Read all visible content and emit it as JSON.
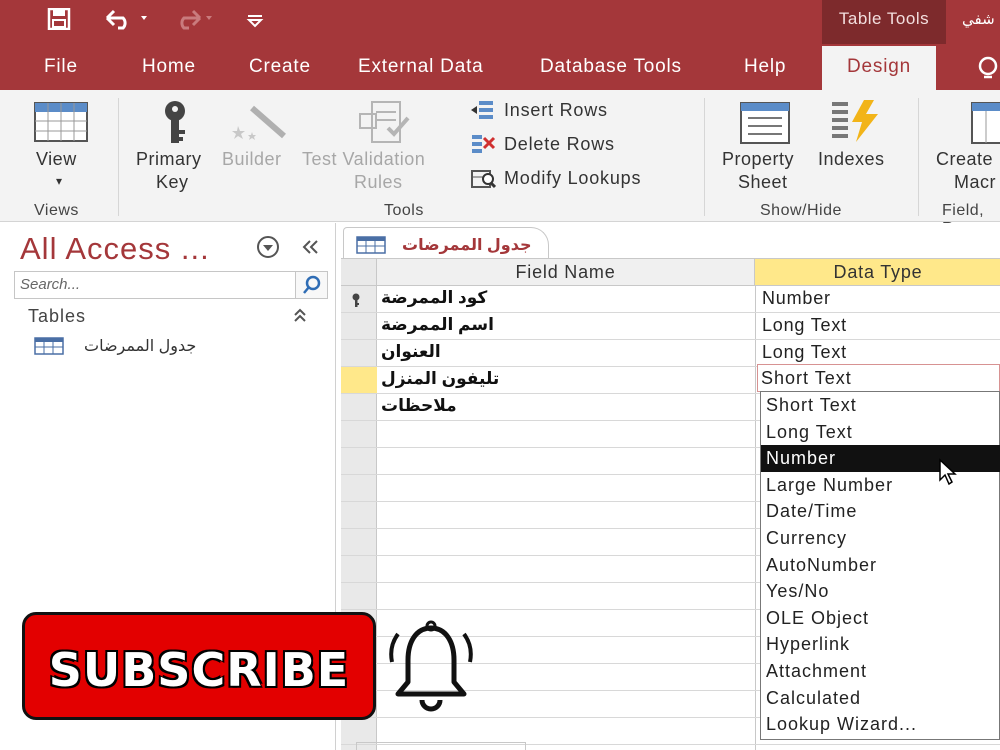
{
  "title_bar": {
    "context_tab": "Table Tools",
    "title_partial": "شفي"
  },
  "ribbon_tabs": [
    "File",
    "Home",
    "Create",
    "External Data",
    "Database Tools",
    "Help",
    "Design"
  ],
  "ribbon": {
    "view": {
      "label": "View",
      "group": "Views"
    },
    "primary_key": {
      "line1": "Primary",
      "line2": "Key"
    },
    "builder": "Builder",
    "test_validation": {
      "line1": "Test Validation",
      "line2": "Rules"
    },
    "insert_rows": "Insert Rows",
    "delete_rows": "Delete Rows",
    "modify_lookups": "Modify Lookups",
    "tools_group": "Tools",
    "property_sheet": {
      "line1": "Property",
      "line2": "Sheet"
    },
    "indexes": "Indexes",
    "showhide_group": "Show/Hide",
    "create_macros": {
      "line1": "Create",
      "line2": "Macr"
    },
    "field_group": "Field, R"
  },
  "nav": {
    "title": "All Access ...",
    "search_placeholder": "Search...",
    "section": "Tables",
    "items": [
      {
        "label": "جدول الممرضات"
      }
    ]
  },
  "document": {
    "tab_label": "جدول الممرضات",
    "headers": {
      "field_name": "Field Name",
      "data_type": "Data Type"
    },
    "rows": [
      {
        "field": "كود الممرضة",
        "type": "Number",
        "primary_key": true
      },
      {
        "field": "اسم الممرضة",
        "type": "Long Text"
      },
      {
        "field": "العنوان",
        "type": "Long Text"
      },
      {
        "field": "تليفون المنزل",
        "type": "Short Text"
      },
      {
        "field": "ملاحظات",
        "type": ""
      }
    ]
  },
  "dropdown": {
    "current": "Short Text",
    "options": [
      "Short Text",
      "Long Text",
      "Number",
      "Large Number",
      "Date/Time",
      "Currency",
      "AutoNumber",
      "Yes/No",
      "OLE Object",
      "Hyperlink",
      "Attachment",
      "Calculated",
      "Lookup Wizard..."
    ],
    "highlighted_index": 2
  },
  "overlay": {
    "subscribe_label": "SUBSCRIBE"
  },
  "colors": {
    "accent": "#a4373a",
    "ribbon_bg": "#f3f3f3",
    "highlight": "#ffe88a"
  }
}
